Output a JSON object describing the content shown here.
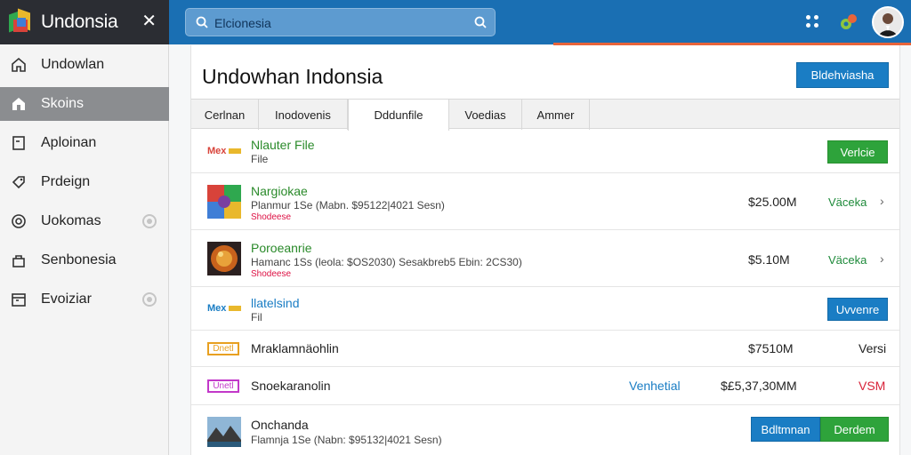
{
  "app": {
    "title": "Undonsia",
    "close_symbol": "✕"
  },
  "search": {
    "placeholder": "Elcionesia",
    "value": ""
  },
  "sidebar": {
    "items": [
      {
        "label": "Undowlan",
        "icon": "home-outline-icon"
      },
      {
        "label": "Skoins",
        "icon": "home-filled-icon"
      },
      {
        "label": "Aploinan",
        "icon": "document-icon"
      },
      {
        "label": "Prdeign",
        "icon": "tag-icon"
      },
      {
        "label": "Uokomas",
        "icon": "circle-icon"
      },
      {
        "label": "Senbonesia",
        "icon": "bag-icon"
      },
      {
        "label": "Evoiziar",
        "icon": "calendar-icon"
      }
    ],
    "active_index": 1
  },
  "main": {
    "title": "Undowhan Indonsia",
    "primary_button": "Bldehviasha"
  },
  "tabs": [
    {
      "label": "Cerlnan"
    },
    {
      "label": "Inodovenis"
    },
    {
      "label": "Dddunfile"
    },
    {
      "label": "Voedias"
    },
    {
      "label": "Ammer"
    }
  ],
  "active_tab": 2,
  "rows": [
    {
      "logo_text": "Mex",
      "title": "Nlauter File",
      "subtitle": "File",
      "button": "Verlcie"
    },
    {
      "title": "Nargiokae",
      "subtitle": "Planmur 1Se (Mabn. $95122|4021 Sesn)",
      "tag": "Shodeese",
      "price": "$25.00M",
      "status": "Väceka"
    },
    {
      "title": "Poroeanrie",
      "subtitle": "Hamanc 1Ss (leola: $OS2030) Sesakbreb5 Ebin: 2CS30)",
      "tag": "Shodeese",
      "price": "$5.10M",
      "status": "Väceka"
    },
    {
      "logo_text": "Mex",
      "title": "llatelsind",
      "subtitle": "Fil",
      "button": "Uvvenre"
    },
    {
      "label_text": "Dnetl",
      "title": "Mraklamnäohlin",
      "price": "$7510M",
      "status": "Versi"
    },
    {
      "label_text": "Unetl",
      "title": "Snoekaranolin",
      "link": "Venhetial",
      "price": "$£5,37,30MM",
      "status": "VSM"
    },
    {
      "title": "Onchanda",
      "subtitle": "Flamnja 1Se (Nabn: $95132|4021 Sesn)",
      "button_blue": "Bdltmnan",
      "button_green": "Derdem"
    }
  ],
  "colors": {
    "topbar": "#1a6fb3",
    "brand_bg": "#2b2d33",
    "accent_orange": "#e8643a",
    "green": "#2ea33b",
    "blue": "#1a7dc4"
  }
}
